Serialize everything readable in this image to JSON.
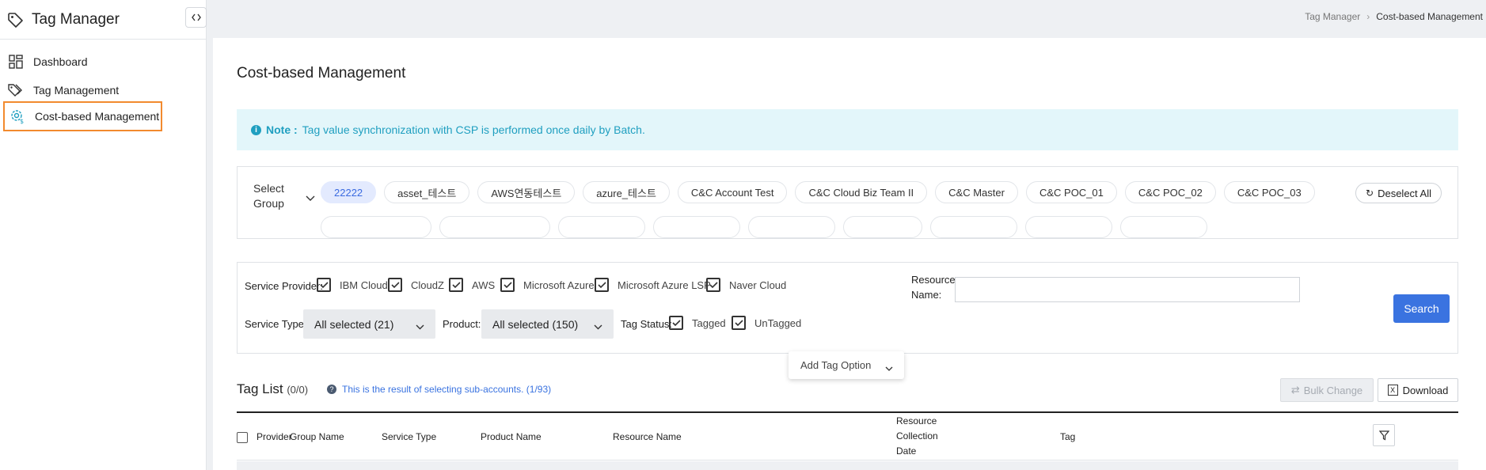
{
  "app": {
    "title": "Tag Manager"
  },
  "sidebar": {
    "items": [
      {
        "label": "Dashboard",
        "icon": "dashboard-icon"
      },
      {
        "label": "Tag Management",
        "icon": "tags-icon"
      },
      {
        "label": "Cost-based Management",
        "icon": "gear-cost-icon",
        "active": true
      }
    ]
  },
  "breadcrumb": {
    "root": "Tag Manager",
    "current": "Cost-based Management"
  },
  "page": {
    "title": "Cost-based Management"
  },
  "note": {
    "label": "Note :",
    "text": "Tag value synchronization with CSP is performed once daily by Batch."
  },
  "group_select": {
    "label_line1": "Select",
    "label_line2": "Group",
    "chips": [
      "22222",
      "asset_테스트",
      "AWS연동테스트",
      "azure_테스트",
      "C&C Account Test",
      "C&C Cloud Biz Team II",
      "C&C Master",
      "C&C POC_01",
      "C&C POC_02",
      "C&C POC_03"
    ],
    "selected": "22222",
    "deselect_label": "Deselect All"
  },
  "filters": {
    "service_provider_label": "Service Provider:",
    "providers": [
      "IBM Cloud",
      "CloudZ",
      "AWS",
      "Microsoft Azure",
      "Microsoft Azure LSP",
      "Naver Cloud"
    ],
    "resource_name_label_1": "Resource",
    "resource_name_label_2": "Name:",
    "resource_name_value": "",
    "search_label": "Search",
    "service_type_label": "Service Type:",
    "service_type_value": "All selected (21)",
    "product_label": "Product:",
    "product_value": "All selected (150)",
    "tag_status_label": "Tag Status:",
    "tag_statuses": [
      "Tagged",
      "UnTagged"
    ],
    "add_tag_option_label": "Add Tag Option"
  },
  "tag_list": {
    "title": "Tag List",
    "count": "(0/0)",
    "sub_note": "This is the result of selecting sub-accounts. (1/93)",
    "bulk_change_label": "Bulk Change",
    "download_label": "Download",
    "columns": {
      "provider": "Provider",
      "group_name": "Group Name",
      "service_type": "Service Type",
      "product_name": "Product Name",
      "resource_name": "Resource Name",
      "collection_1": "Resource",
      "collection_2": "Collection",
      "collection_3": "Date",
      "tag": "Tag"
    }
  },
  "colors": {
    "accent": "#3a73e0",
    "active_outline": "#f28a2e",
    "note_bg": "#e3f6fa",
    "note_text": "#1f9fc0"
  }
}
